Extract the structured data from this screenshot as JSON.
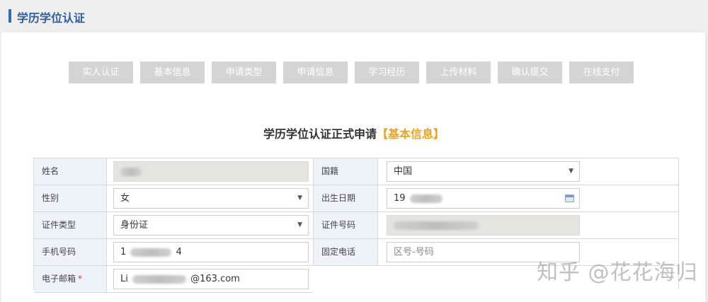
{
  "header": {
    "title": "学历学位认证"
  },
  "steps": [
    "实人认证",
    "基本信息",
    "申请类型",
    "申请信息",
    "学习经历",
    "上传材料",
    "确认提交",
    "在线支付"
  ],
  "form_heading": {
    "title": "学历学位认证正式申请",
    "subtitle": "【基本信息】"
  },
  "form": {
    "name": {
      "label": "姓名",
      "value": ""
    },
    "nationality": {
      "label": "国籍",
      "value": "中国"
    },
    "gender": {
      "label": "性别",
      "value": "女"
    },
    "birth_date": {
      "label": "出生日期",
      "value": "19"
    },
    "id_type": {
      "label": "证件类型",
      "value": "身份证"
    },
    "id_number": {
      "label": "证件号码",
      "value": ""
    },
    "mobile": {
      "label": "手机号码",
      "value_start": "1",
      "value_end": "4"
    },
    "landline": {
      "label": "固定电话",
      "placeholder": "区号-号码"
    },
    "email": {
      "label": "电子邮箱",
      "required_mark": "*",
      "value_start": "Li",
      "value_end": "@163.com"
    }
  },
  "watermark": "知乎 @花花海归",
  "icons": {
    "dropdown": "chevron-down-icon",
    "calendar": "calendar-icon"
  }
}
